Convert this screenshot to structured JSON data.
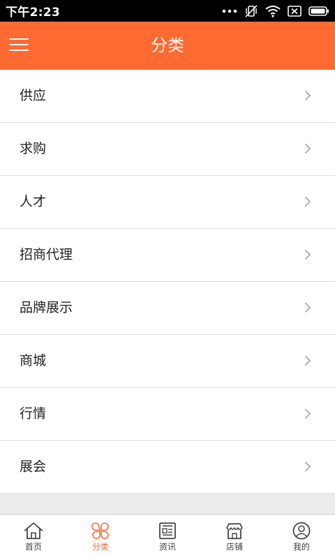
{
  "status_bar": {
    "time": "下午2:23"
  },
  "header": {
    "title": "分类",
    "menu_icon": "menu-icon"
  },
  "categories": [
    {
      "label": "供应"
    },
    {
      "label": "求购"
    },
    {
      "label": "人才"
    },
    {
      "label": "招商代理"
    },
    {
      "label": "品牌展示"
    },
    {
      "label": "商城"
    },
    {
      "label": "行情"
    },
    {
      "label": "展会"
    }
  ],
  "tabs": [
    {
      "label": "首页",
      "icon": "home-icon",
      "active": false
    },
    {
      "label": "分类",
      "icon": "category-icon",
      "active": true
    },
    {
      "label": "资讯",
      "icon": "news-icon",
      "active": false
    },
    {
      "label": "店铺",
      "icon": "shop-icon",
      "active": false
    },
    {
      "label": "我的",
      "icon": "user-icon",
      "active": false
    }
  ],
  "colors": {
    "accent": "#ff6a33",
    "status_bar": "#000000",
    "background": "#ececec"
  }
}
